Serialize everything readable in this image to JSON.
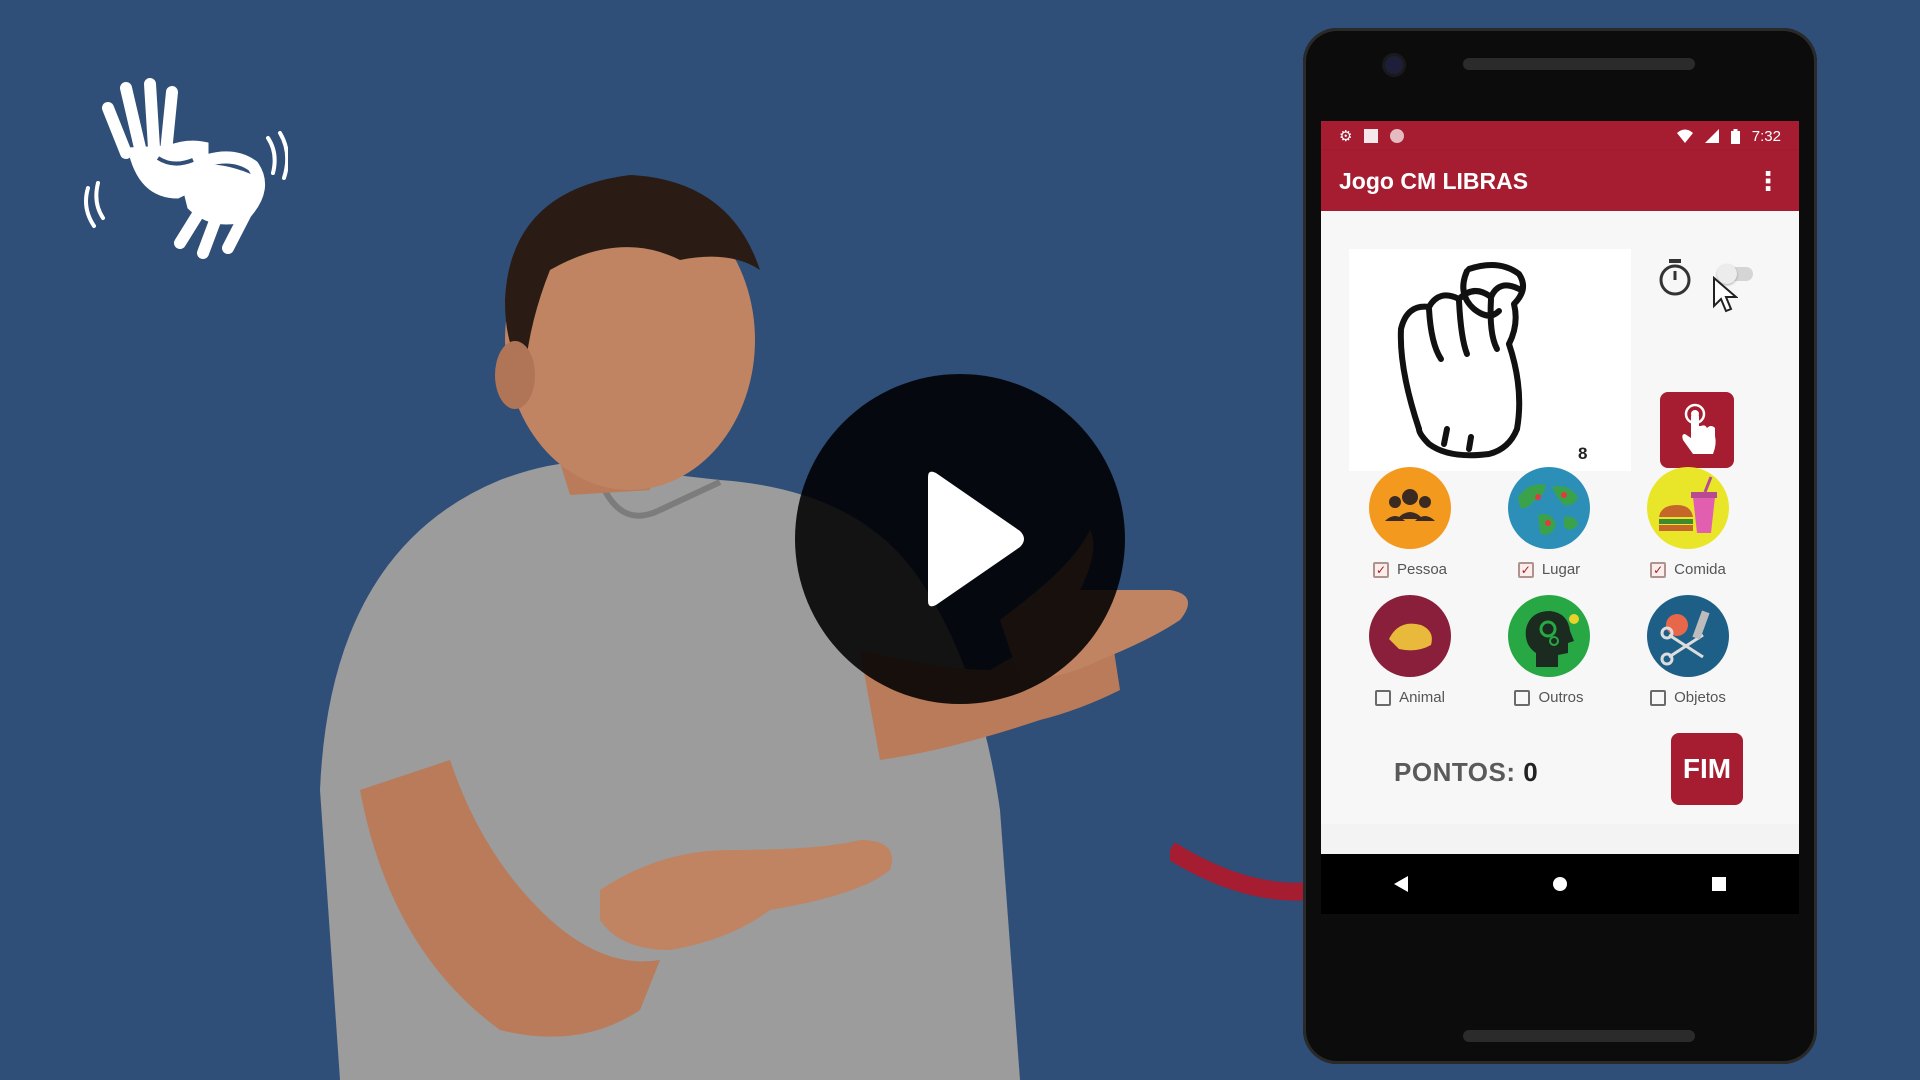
{
  "colors": {
    "background": "#2f4f78",
    "brand_red": "#a61c30",
    "phone_body": "#0c0c0c"
  },
  "logo": {
    "icon": "sign-language-hands-icon"
  },
  "video": {
    "play_icon": "play-icon"
  },
  "phone": {
    "status_bar": {
      "left_icons": [
        "gear-icon",
        "sd-card-icon",
        "circle-icon"
      ],
      "right_icons": [
        "wifi-icon",
        "signal-icon",
        "battery-icon"
      ],
      "time": "7:32"
    },
    "app_bar": {
      "title": "Jogo CM LIBRAS",
      "menu_icon": "more-vert-icon"
    },
    "sign_card": {
      "number": "8",
      "image": "hand-sign-icon"
    },
    "timer": {
      "icon": "stopwatch-icon",
      "toggle_on": false
    },
    "tap_button": {
      "icon": "tap-hand-icon"
    },
    "categories": [
      {
        "label": "Pessoa",
        "checked": true,
        "icon": "people-icon",
        "color": "#f39a1e"
      },
      {
        "label": "Lugar",
        "checked": true,
        "icon": "globe-icon",
        "color": "#2c8fb8"
      },
      {
        "label": "Comida",
        "checked": true,
        "icon": "food-icon",
        "color": "#e9e62a"
      },
      {
        "label": "Animal",
        "checked": false,
        "icon": "animal-icon",
        "color": "#8a1f3b"
      },
      {
        "label": "Outros",
        "checked": false,
        "icon": "head-gears-icon",
        "color": "#27a844"
      },
      {
        "label": "Objetos",
        "checked": false,
        "icon": "tools-icon",
        "color": "#1d5f86"
      }
    ],
    "points": {
      "label": "PONTOS:",
      "value": "0"
    },
    "fim_button": {
      "label": "FIM"
    },
    "nav": [
      "back-icon",
      "home-icon",
      "recents-icon"
    ]
  }
}
